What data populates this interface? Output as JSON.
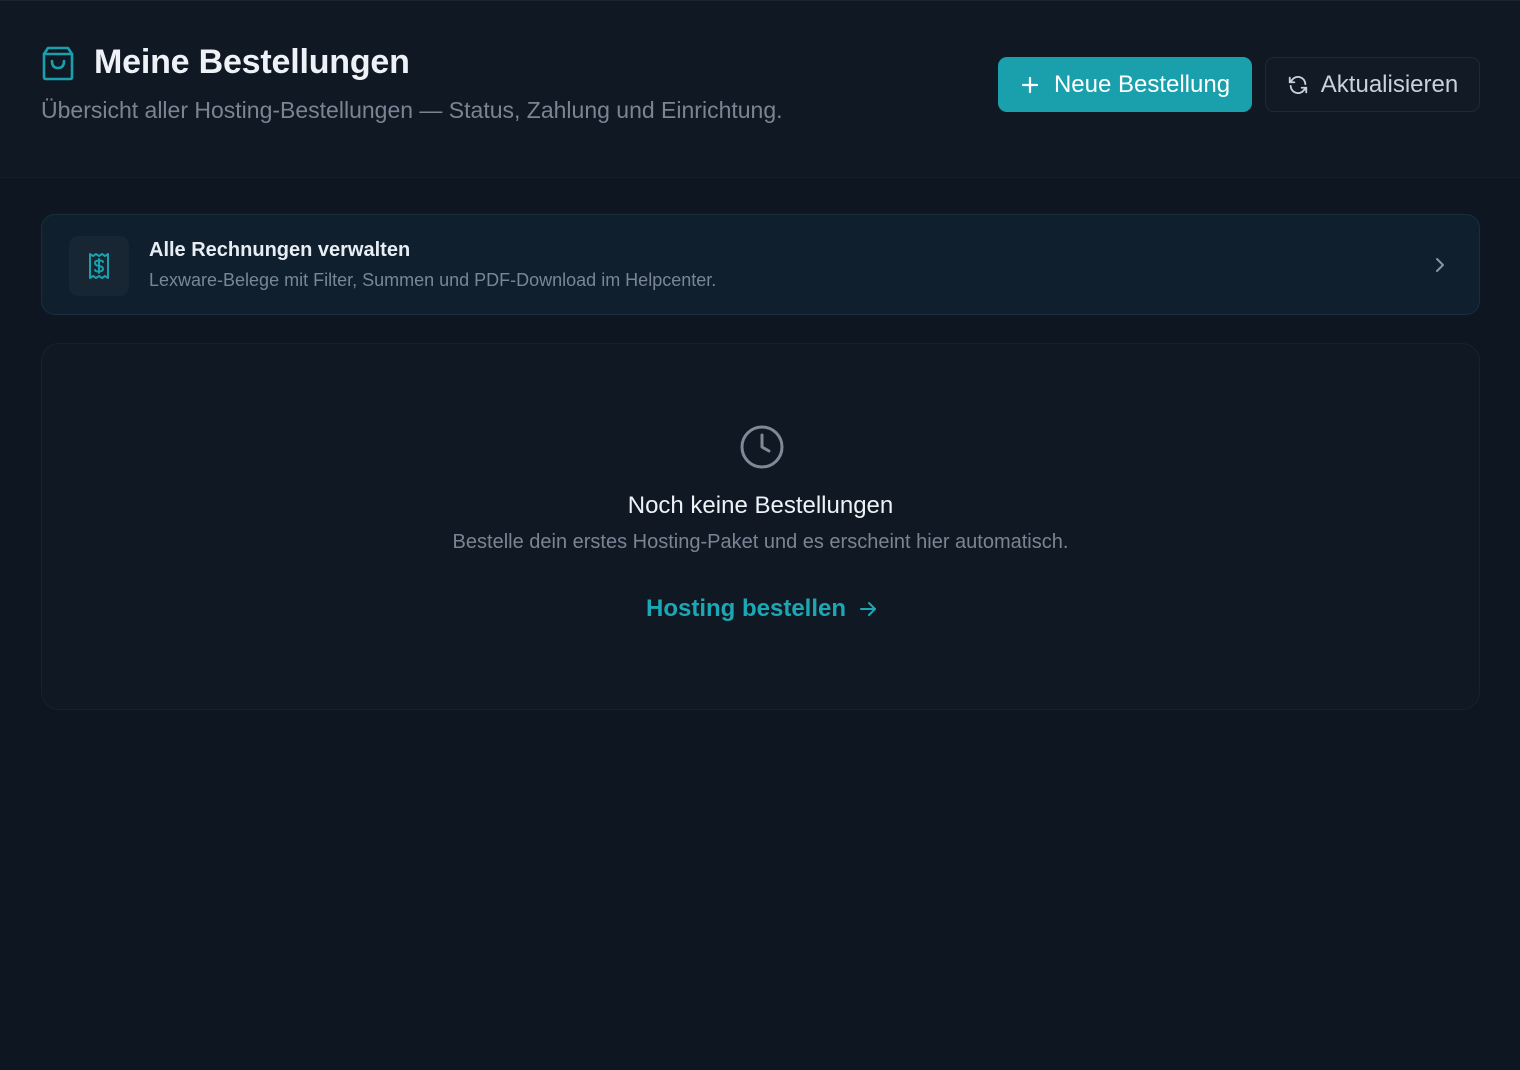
{
  "header": {
    "title": "Meine Bestellungen",
    "subtitle": "Übersicht aller Hosting-Bestellungen — Status, Zahlung und Einrichtung.",
    "title_icon": "shopping-bag-icon",
    "primary_button": {
      "label": "Neue Bestellung",
      "icon": "plus-icon"
    },
    "secondary_button": {
      "label": "Aktualisieren",
      "icon": "refresh-icon"
    }
  },
  "invoices_card": {
    "icon": "receipt-dollar-icon",
    "title": "Alle Rechnungen verwalten",
    "description": "Lexware-Belege mit Filter, Summen und PDF-Download im Helpcenter.",
    "trailing_icon": "chevron-right-icon"
  },
  "empty_state": {
    "icon": "clock-icon",
    "title": "Noch keine Bestellungen",
    "description": "Bestelle dein erstes Hosting-Paket und es erscheint hier automatisch.",
    "link_label": "Hosting bestellen",
    "link_icon": "arrow-right-icon"
  },
  "colors": {
    "background": "#0e1621",
    "accent": "#1aa0ad",
    "accent_text": "#1ba7b4",
    "text_primary": "#eef2f7",
    "text_muted": "#7a8594"
  }
}
